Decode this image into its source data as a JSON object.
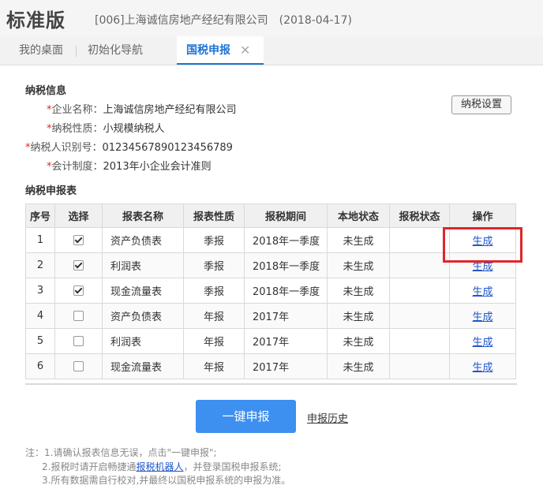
{
  "header": {
    "edition": "标准版",
    "company": "[006]上海诚信房地产经纪有限公司",
    "date": "(2018-04-17)"
  },
  "tabs": [
    {
      "label": "我的桌面",
      "active": false
    },
    {
      "label": "初始化导航",
      "active": false
    },
    {
      "label": "国税申报",
      "active": true
    }
  ],
  "tab_close_glyph": "✕",
  "tax_info": {
    "title": "纳税信息",
    "settings_button": "纳税设置",
    "required_mark": "*",
    "fields": [
      {
        "label": "企业名称：",
        "value": "上海诚信房地产经纪有限公司"
      },
      {
        "label": "纳税性质：",
        "value": "小规模纳税人"
      },
      {
        "label": "纳税人识别号：",
        "value": "01234567890123456789"
      },
      {
        "label": "会计制度：",
        "value": "2013年小企业会计准则"
      }
    ]
  },
  "report_table": {
    "title": "纳税申报表",
    "columns": [
      "序号",
      "选择",
      "报表名称",
      "报表性质",
      "报税期间",
      "本地状态",
      "报税状态",
      "操作"
    ],
    "rows": [
      {
        "no": "1",
        "checked": true,
        "name": "资产负债表",
        "nature": "季报",
        "period": "2018年一季度",
        "local_status": "未生成",
        "tax_status": "",
        "action": "生成"
      },
      {
        "no": "2",
        "checked": true,
        "name": "利润表",
        "nature": "季报",
        "period": "2018年一季度",
        "local_status": "未生成",
        "tax_status": "",
        "action": "生成"
      },
      {
        "no": "3",
        "checked": true,
        "name": "现金流量表",
        "nature": "季报",
        "period": "2018年一季度",
        "local_status": "未生成",
        "tax_status": "",
        "action": "生成"
      },
      {
        "no": "4",
        "checked": false,
        "name": "资产负债表",
        "nature": "年报",
        "period": "2017年",
        "local_status": "未生成",
        "tax_status": "",
        "action": "生成"
      },
      {
        "no": "5",
        "checked": false,
        "name": "利润表",
        "nature": "年报",
        "period": "2017年",
        "local_status": "未生成",
        "tax_status": "",
        "action": "生成"
      },
      {
        "no": "6",
        "checked": false,
        "name": "现金流量表",
        "nature": "年报",
        "period": "2017年",
        "local_status": "未生成",
        "tax_status": "",
        "action": "生成"
      }
    ]
  },
  "actions": {
    "submit": "一键申报",
    "history": "申报历史"
  },
  "notes": {
    "line1": "注：1.请确认报表信息无误，点击\"一键申报\";",
    "line2_prefix": "2.报税时请开启畅捷通",
    "line2_link": "报税机器人",
    "line2_suffix": "，并登录国税申报系统;",
    "line3": "3.所有数据需自行校对,并最终以国税申报系统的申报为准。"
  },
  "colors": {
    "accent": "#1f73d6",
    "submit_button": "#3d8ff0",
    "highlight": "#e0262b"
  }
}
